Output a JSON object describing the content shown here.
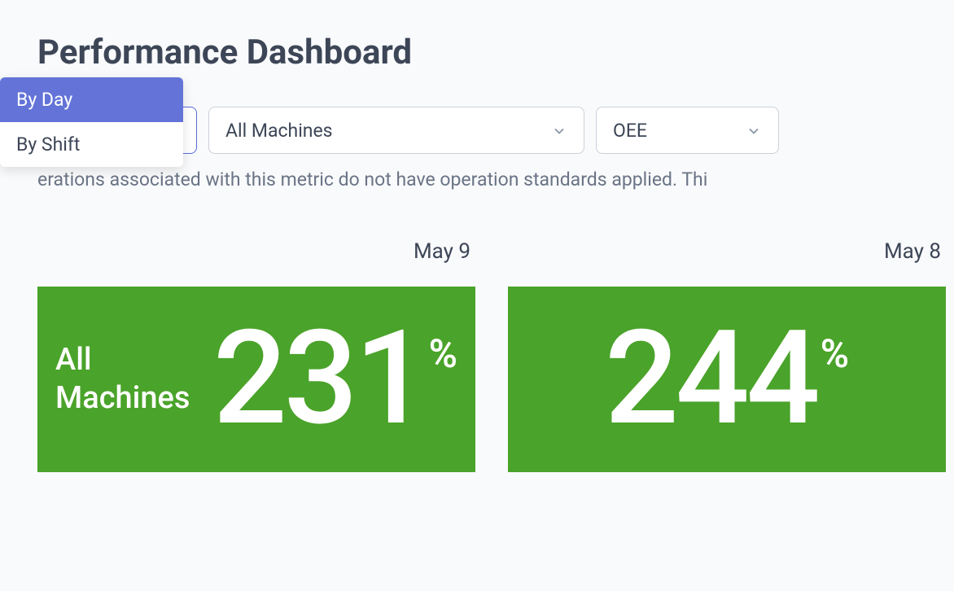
{
  "page_title": "Performance Dashboard",
  "filters": {
    "period": {
      "selected": "By Day",
      "options": [
        "By Day",
        "By Shift"
      ]
    },
    "machine": {
      "selected": "All Machines"
    },
    "metric": {
      "selected": "OEE"
    }
  },
  "info_text": "erations associated with this metric do not have operation standards applied. Thi",
  "columns": [
    {
      "date_label": "May 9",
      "card": {
        "label": "All Machines",
        "value": "231",
        "unit": "%"
      }
    },
    {
      "date_label": "May 8",
      "card": {
        "label": "",
        "value": "244",
        "unit": "%"
      }
    }
  ]
}
